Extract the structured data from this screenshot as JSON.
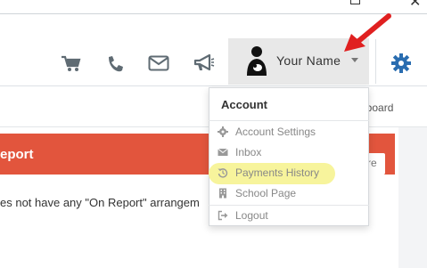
{
  "header": {
    "user_name": "Your Name",
    "icons": [
      "cart-icon",
      "phone-icon",
      "envelope-icon",
      "bullhorn-icon",
      "user-avatar-icon",
      "gear-icon"
    ],
    "accent_color": "#2a6db0"
  },
  "subheader": {
    "dashboard_link": "shboard"
  },
  "panel": {
    "title": "eport",
    "more_label": "re",
    "body_text": "es not have any \"On Report\" arrangem",
    "header_color": "#e2553d"
  },
  "dropdown": {
    "heading": "Account",
    "items": [
      {
        "label": "Account Settings",
        "icon": "gear-icon"
      },
      {
        "label": "Inbox",
        "icon": "envelope-icon"
      },
      {
        "label": "Payments History",
        "icon": "history-icon"
      },
      {
        "label": "School Page",
        "icon": "building-icon"
      },
      {
        "label": "Logout",
        "icon": "sign-out-icon"
      }
    ],
    "highlight_color": "#f7f49c"
  },
  "annotation": {
    "arrow_color": "#e02020"
  }
}
